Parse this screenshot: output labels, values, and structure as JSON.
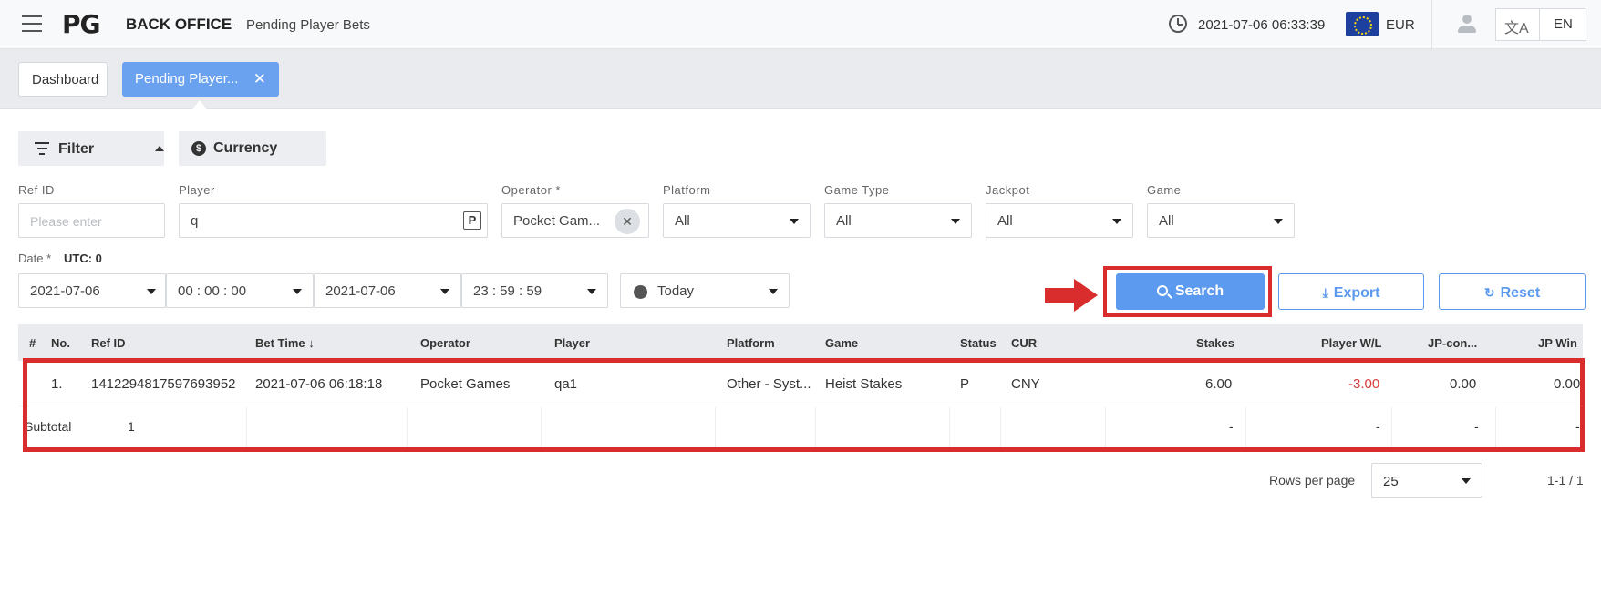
{
  "header": {
    "logo": "PG",
    "app_title": "BACK OFFICE",
    "separator": "-",
    "page_title": "Pending Player Bets",
    "datetime": "2021-07-06 06:33:39",
    "currency": "EUR",
    "translate_glyph": "文A",
    "language": "EN"
  },
  "tabs": {
    "dashboard": "Dashboard",
    "active": "Pending Player...",
    "close": "✕"
  },
  "filters": {
    "filter_label": "Filter",
    "currency_label": "Currency",
    "currency_glyph": "$",
    "fields": {
      "ref_id": {
        "label": "Ref ID",
        "placeholder": "Please enter"
      },
      "player": {
        "label": "Player",
        "value": "q",
        "badge": "P"
      },
      "operator": {
        "label": "Operator *",
        "value": "Pocket Gam...",
        "clear": "✕"
      },
      "platform": {
        "label": "Platform",
        "value": "All"
      },
      "game_type": {
        "label": "Game Type",
        "value": "All"
      },
      "jackpot": {
        "label": "Jackpot",
        "value": "All"
      },
      "game": {
        "label": "Game",
        "value": "All"
      }
    },
    "date": {
      "label": "Date *",
      "utc": "UTC: 0",
      "start_date": "2021-07-06",
      "start_time": "00 : 00 : 00",
      "end_date": "2021-07-06",
      "end_time": "23 : 59 : 59",
      "preset": "Today"
    }
  },
  "actions": {
    "search": "Search",
    "export": "Export",
    "export_glyph": "⤓",
    "reset": "Reset",
    "reset_glyph": "↻"
  },
  "table": {
    "columns": [
      "#",
      "No.",
      "Ref ID",
      "Bet Time",
      "Operator",
      "Player",
      "Platform",
      "Game",
      "Status",
      "CUR",
      "Stakes",
      "Player W/L",
      "JP-con...",
      "JP Win"
    ],
    "sort_glyph": "↓",
    "rows": [
      {
        "no": "1.",
        "ref_id": "1412294817597693952",
        "bet_time": "2021-07-06 06:18:18",
        "operator": "Pocket Games",
        "player": "qa1",
        "platform": "Other - Syst...",
        "game": "Heist Stakes",
        "status": "P",
        "cur": "CNY",
        "stakes": "6.00",
        "player_wl": "-3.00",
        "jp_con": "0.00",
        "jp_win": "0.00"
      }
    ],
    "subtotal": {
      "label": "Subtotal",
      "count": "1",
      "stakes": "-",
      "player_wl": "-",
      "jp_con": "-",
      "jp_win": "-"
    }
  },
  "pager": {
    "rows_per_page_label": "Rows per page",
    "rows_per_page": "25",
    "range": "1-1 / 1"
  }
}
